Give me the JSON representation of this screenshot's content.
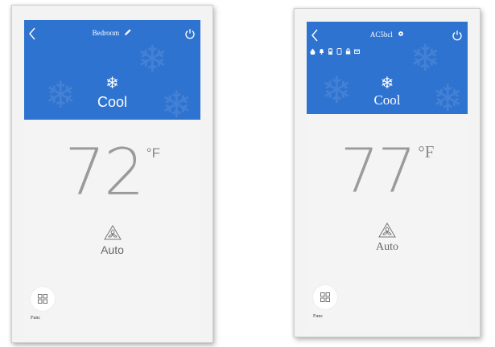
{
  "colors": {
    "header_blue": "#2f73d0",
    "screen_bg": "#f4f4f4",
    "temp_gray": "#9a9a9a"
  },
  "screens": [
    {
      "title": "Bedroom",
      "title_icon": "edit-icon",
      "back_icon": "back-icon",
      "power_icon": "power-icon",
      "mode_icon": "snowflake-icon",
      "mode_label": "Cool",
      "temperature": "72",
      "unit": "°F",
      "fan_icon": "fan-icon",
      "fan_label": "Auto",
      "function_icon": "grid-icon",
      "function_label": "Func"
    },
    {
      "title": "AC5bcl",
      "title_icon": "gear-icon",
      "back_icon": "back-icon",
      "power_icon": "power-icon",
      "status_icons": [
        "drop-icon",
        "bell-icon",
        "battery-icon",
        "phone-icon",
        "lock-icon",
        "mail-icon"
      ],
      "mode_icon": "snowflake-icon",
      "mode_label": "Cool",
      "temperature": "77",
      "unit": "°F",
      "fan_icon": "fan-icon",
      "fan_label": "Auto",
      "function_icon": "grid-icon",
      "function_label": "Func"
    }
  ]
}
